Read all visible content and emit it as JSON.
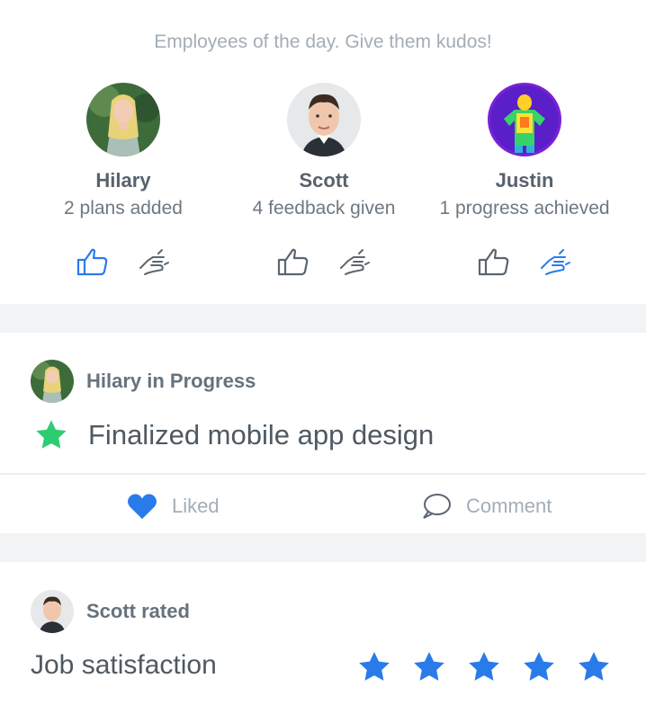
{
  "kudos": {
    "title": "Employees of the day. Give them kudos!",
    "employees": [
      {
        "name": "Hilary",
        "stat": "2 plans added",
        "avatar": "avatar-hilary",
        "liked": true,
        "high_fived": false
      },
      {
        "name": "Scott",
        "stat": "4 feedback given",
        "avatar": "avatar-scott",
        "liked": false,
        "high_fived": false
      },
      {
        "name": "Justin",
        "stat": "1 progress achieved",
        "avatar": "avatar-justin",
        "liked": false,
        "high_fived": true
      }
    ]
  },
  "progress_post": {
    "author_line": "Hilary in Progress",
    "content": "Finalized mobile app design",
    "icon": "star-icon",
    "like_label": "Liked",
    "comment_label": "Comment"
  },
  "rating_post": {
    "author_line": "Scott rated",
    "label": "Job satisfaction",
    "rating": 5,
    "max_rating": 5
  },
  "colors": {
    "accent": "#2a7bea",
    "icon_gray": "#5b6670",
    "green_star": "#2ecc71",
    "divider_band": "#f1f3f5"
  }
}
